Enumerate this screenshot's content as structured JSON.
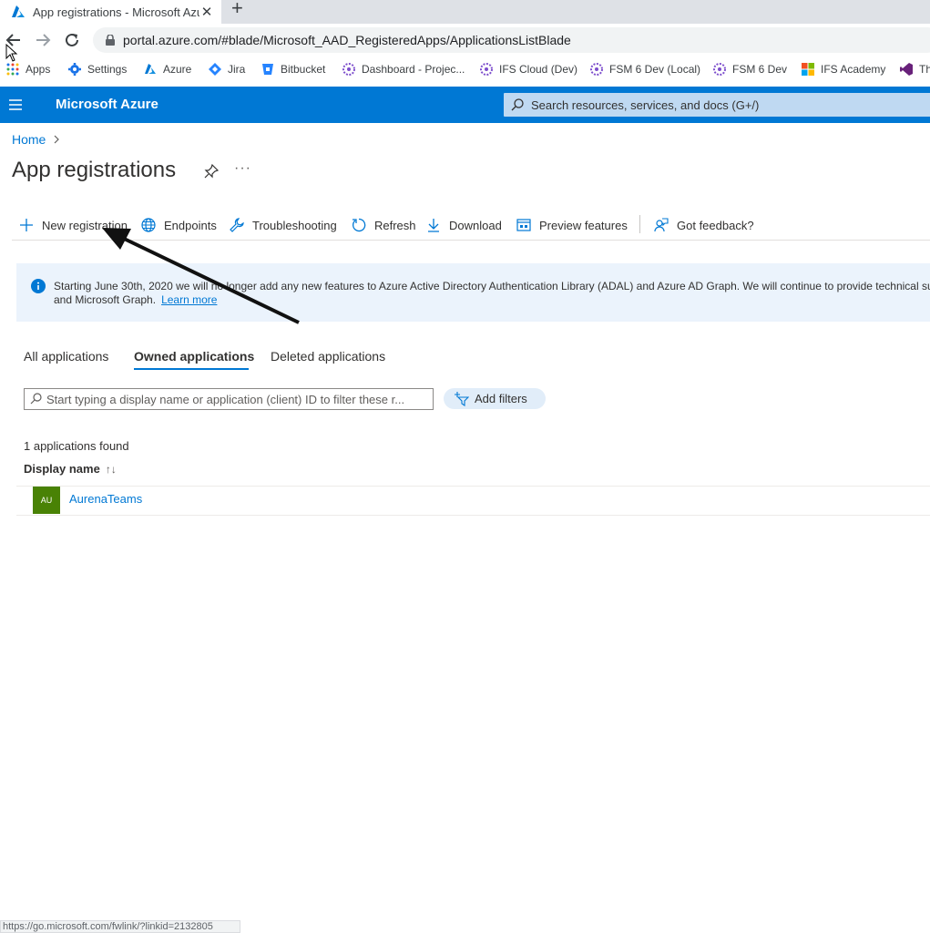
{
  "browser": {
    "tab_title": "App registrations - Microsoft Azu",
    "url": "portal.azure.com/#blade/Microsoft_AAD_RegisteredApps/ApplicationsListBlade",
    "bookmarks": [
      {
        "label": "Apps",
        "icon": "apps-grid-icon"
      },
      {
        "label": "Settings",
        "icon": "gear-icon"
      },
      {
        "label": "Azure",
        "icon": "azure-icon"
      },
      {
        "label": "Jira",
        "icon": "jira-icon"
      },
      {
        "label": "Bitbucket",
        "icon": "bitbucket-icon"
      },
      {
        "label": "Dashboard - Projec...",
        "icon": "ifs-icon"
      },
      {
        "label": "IFS Cloud (Dev)",
        "icon": "ifs-icon"
      },
      {
        "label": "FSM 6 Dev (Local)",
        "icon": "ifs-icon"
      },
      {
        "label": "FSM 6 Dev",
        "icon": "ifs-icon"
      },
      {
        "label": "IFS Academy",
        "icon": "microsoft-icon"
      },
      {
        "label": "Th",
        "icon": "visual-studio-icon"
      }
    ],
    "status_url": "https://go.microsoft.com/fwlink/?linkid=2132805"
  },
  "azure": {
    "brand": "Microsoft Azure",
    "search_placeholder": "Search resources, services, and docs (G+/)"
  },
  "page": {
    "breadcrumb": "Home",
    "title": "App registrations",
    "more": "···"
  },
  "commands": {
    "new_registration": "New registration",
    "endpoints": "Endpoints",
    "troubleshooting": "Troubleshooting",
    "refresh": "Refresh",
    "download": "Download",
    "preview_features": "Preview features",
    "got_feedback": "Got feedback?"
  },
  "banner": {
    "line1": "Starting June 30th, 2020 we will no longer add any new features to Azure Active Directory Authentication Library (ADAL) and Azure AD Graph. We will continue to provide technical su",
    "line2": "and Microsoft Graph.",
    "learn_more": "Learn more"
  },
  "tabs": {
    "all": "All applications",
    "owned": "Owned applications",
    "deleted": "Deleted applications",
    "selected": "Owned applications"
  },
  "filter": {
    "placeholder": "Start typing a display name or application (client) ID to filter these r...",
    "add_filters": "Add filters"
  },
  "list": {
    "count_text": "1 applications found",
    "column_display_name": "Display name",
    "sort_indicator": "↑↓",
    "rows": [
      {
        "initials": "AU",
        "name": "AurenaTeams",
        "avatar_color": "#498205"
      }
    ]
  },
  "colors": {
    "azure_blue": "#0078d4",
    "banner_bg": "#ebf3fc"
  }
}
